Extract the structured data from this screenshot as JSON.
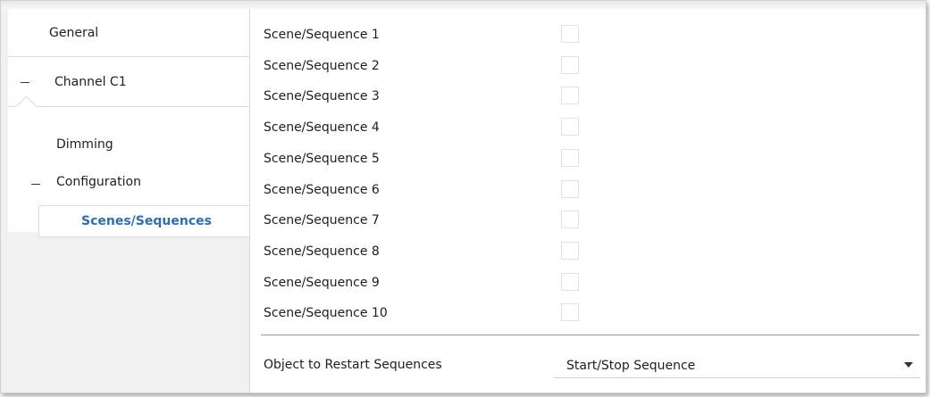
{
  "sidebar": {
    "general": "General",
    "channel": "Channel C1",
    "dimming": "Dimming",
    "configuration": "Configuration",
    "selected": "Scenes/Sequences"
  },
  "scenes": [
    "Scene/Sequence 1",
    "Scene/Sequence 2",
    "Scene/Sequence 3",
    "Scene/Sequence 4",
    "Scene/Sequence 5",
    "Scene/Sequence 6",
    "Scene/Sequence 7",
    "Scene/Sequence 8",
    "Scene/Sequence 9",
    "Scene/Sequence 10"
  ],
  "restart": {
    "label": "Object to Restart Sequences",
    "value": "Start/Stop Sequence"
  },
  "colors": {
    "accent": "#2e6db5",
    "sidebar_bg": "#f1f1f1"
  },
  "icons": {
    "collapse": "minus-icon",
    "dropdown": "chevron-down-icon"
  }
}
